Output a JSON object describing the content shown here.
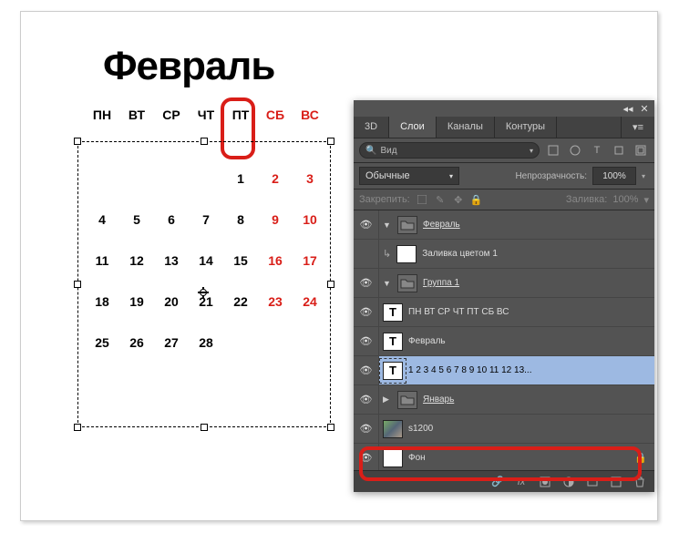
{
  "calendar": {
    "month_title": "Февраль",
    "days_of_week": [
      "ПН",
      "ВТ",
      "СР",
      "ЧТ",
      "ПТ",
      "СБ",
      "ВС"
    ],
    "weekend_indices": [
      5,
      6
    ],
    "weeks": [
      [
        "",
        "",
        "",
        "",
        "1",
        "2",
        "3"
      ],
      [
        "4",
        "5",
        "6",
        "7",
        "8",
        "9",
        "10"
      ],
      [
        "11",
        "12",
        "13",
        "14",
        "15",
        "16",
        "17"
      ],
      [
        "18",
        "19",
        "20",
        "21",
        "22",
        "23",
        "24"
      ],
      [
        "25",
        "26",
        "27",
        "28",
        "",
        "",
        ""
      ]
    ]
  },
  "panel": {
    "tabs": {
      "t3d": "3D",
      "layers": "Слои",
      "channels": "Каналы",
      "paths": "Контуры"
    },
    "filter_placeholder": "Вид",
    "blend_mode": "Обычные",
    "opacity_label": "Непрозрачность:",
    "opacity_value": "100%",
    "lock_label": "Закрепить:",
    "fill_label": "Заливка:",
    "fill_value": "100%",
    "layers": {
      "february_group": "Февраль",
      "color_fill": "Заливка цветом 1",
      "group1": "Группа 1",
      "dow_text": "ПН ВТ СР ЧТ ПТ СБ ВС",
      "month_text": "Февраль",
      "numbers_text": "1 2 3 4 5 6 7 8 9 10 11 12 13...",
      "january_group": "Январь",
      "s1200": "s1200",
      "background": "Фон"
    }
  }
}
